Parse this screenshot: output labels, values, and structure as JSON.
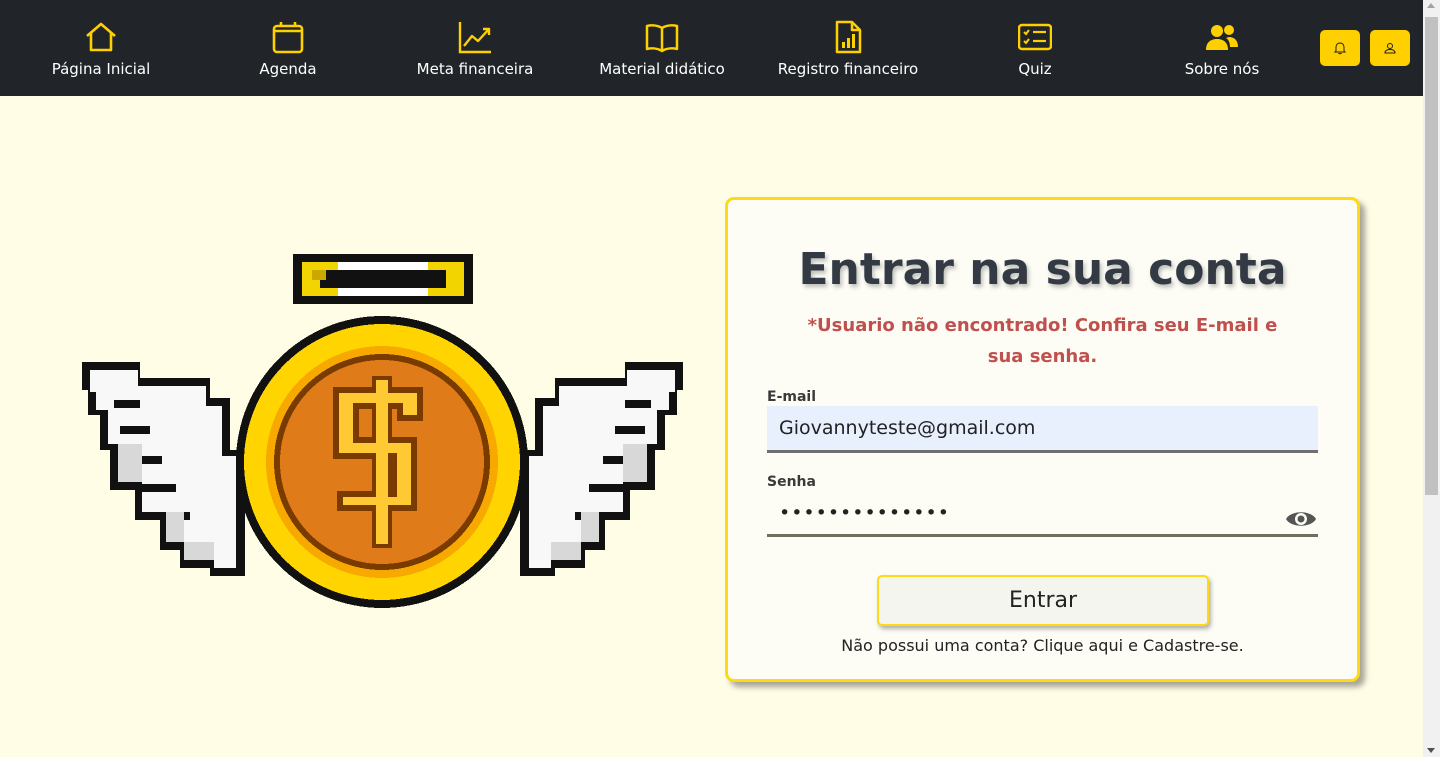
{
  "nav": {
    "items": [
      {
        "label": "Página Inicial",
        "icon": "home-icon"
      },
      {
        "label": "Agenda",
        "icon": "calendar-icon"
      },
      {
        "label": "Meta financeira",
        "icon": "chart-line-icon"
      },
      {
        "label": "Material didático",
        "icon": "book-icon"
      },
      {
        "label": "Registro financeiro",
        "icon": "file-chart-icon"
      },
      {
        "label": "Quiz",
        "icon": "checklist-icon"
      },
      {
        "label": "Sobre nós",
        "icon": "people-icon"
      }
    ],
    "notification_icon": "bell-icon",
    "profile_icon": "user-icon"
  },
  "illustration": {
    "icon": "winged-coin-icon"
  },
  "login": {
    "title": "Entrar na sua conta",
    "error": "*Usuario não encontrado! Confira seu E-mail e sua senha.",
    "email_label": "E-mail",
    "email_value": "Giovannyteste@gmail.com",
    "password_label": "Senha",
    "password_value": "••••••••••••••",
    "password_toggle_icon": "eye-icon",
    "submit_label": "Entrar",
    "signup_prefix": "Não possui uma conta? ",
    "signup_link": "Clique aqui e Cadastre-se."
  },
  "colors": {
    "accent": "#ffd000",
    "navbar": "#212529",
    "page_bg": "#fffde6",
    "error": "#c0504d",
    "email_field_bg": "#e8f0fe"
  }
}
